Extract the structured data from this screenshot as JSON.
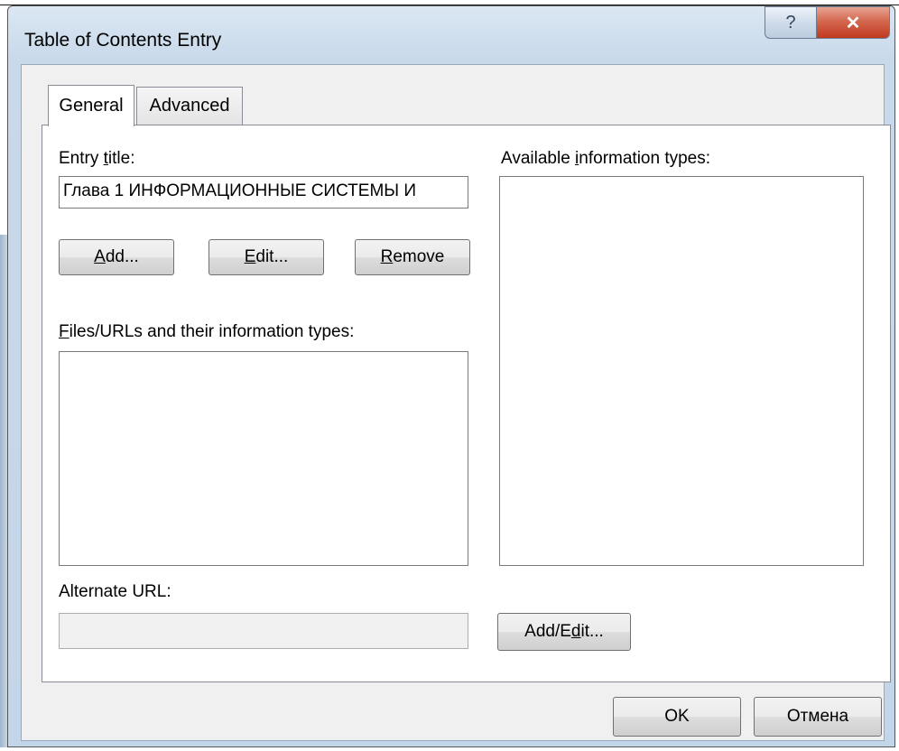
{
  "window": {
    "title": "Table of Contents Entry",
    "help_glyph": "?",
    "close_glyph": "✕"
  },
  "tabs": [
    {
      "label": "General",
      "selected": true
    },
    {
      "label": "Advanced",
      "selected": false
    }
  ],
  "general": {
    "entry_title_label": {
      "pre": "Entry ",
      "key": "t",
      "post": "itle:"
    },
    "entry_title_value": "Глава 1 ИНФОРМАЦИОННЫЕ СИСТЕМЫ И",
    "add_button": {
      "key": "A",
      "post": "dd..."
    },
    "edit_button": {
      "key": "E",
      "post": "dit..."
    },
    "remove_button": {
      "key": "R",
      "post": "emove"
    },
    "files_label": {
      "key": "F",
      "post": "iles/URLs and their information types:"
    },
    "available_label": {
      "pre": "Available ",
      "key": "i",
      "post": "nformation types:"
    },
    "alternate_url_label": "Alternate URL:",
    "alternate_url_value": "",
    "add_edit_button": {
      "pre": "Add/E",
      "key": "d",
      "post": "it..."
    }
  },
  "footer": {
    "ok_label": "OK",
    "cancel_label": "Отмена"
  }
}
